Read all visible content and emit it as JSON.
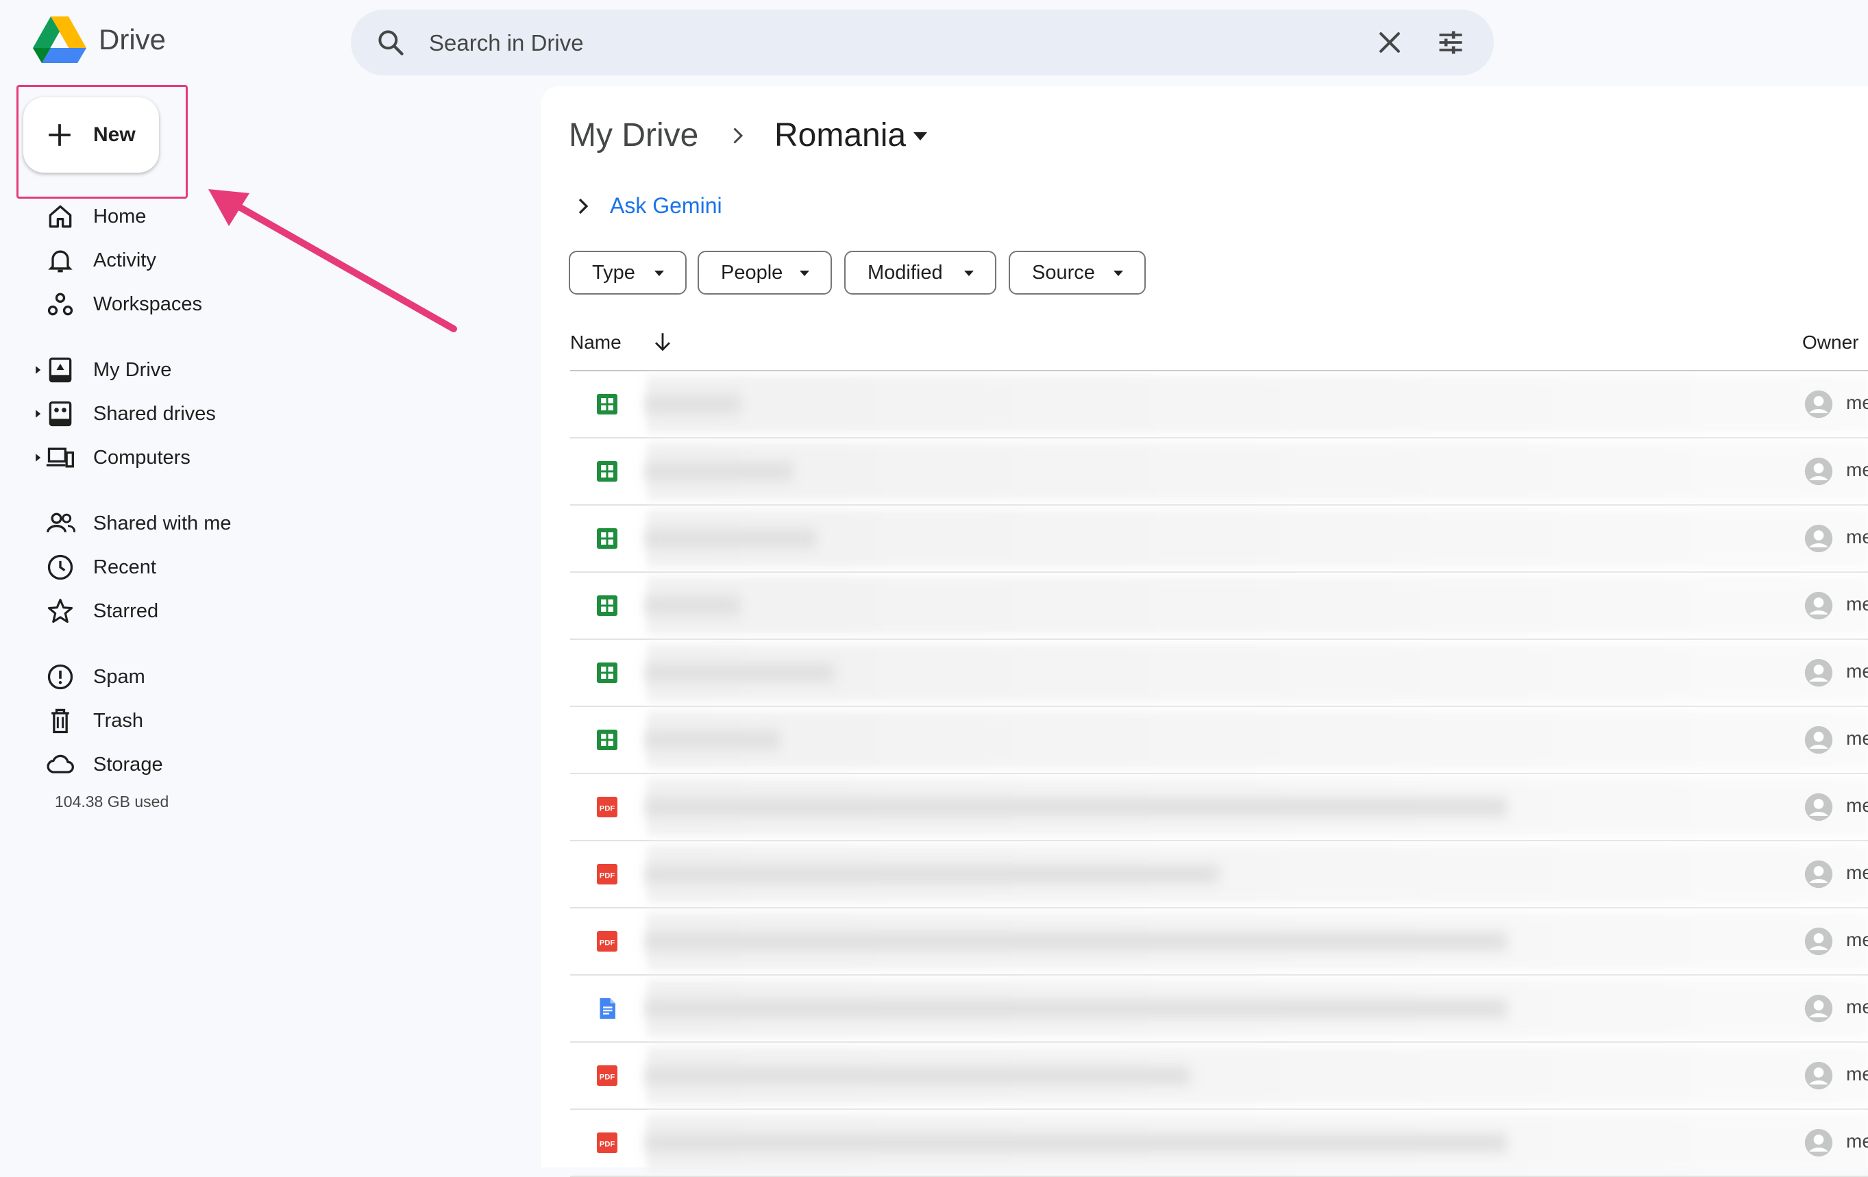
{
  "header": {
    "app_name": "Drive",
    "search_placeholder": "Search in Drive"
  },
  "new_button_label": "New",
  "sidebar": {
    "items": [
      {
        "label": "Home",
        "icon": "home-icon"
      },
      {
        "label": "Activity",
        "icon": "bell-icon"
      },
      {
        "label": "Workspaces",
        "icon": "workspaces-icon"
      },
      {
        "label": "My Drive",
        "icon": "my-drive-icon",
        "expandable": true
      },
      {
        "label": "Shared drives",
        "icon": "shared-drives-icon",
        "expandable": true
      },
      {
        "label": "Computers",
        "icon": "computers-icon",
        "expandable": true
      },
      {
        "label": "Shared with me",
        "icon": "shared-with-me-icon"
      },
      {
        "label": "Recent",
        "icon": "clock-icon"
      },
      {
        "label": "Starred",
        "icon": "star-icon"
      },
      {
        "label": "Spam",
        "icon": "spam-icon"
      },
      {
        "label": "Trash",
        "icon": "trash-icon"
      },
      {
        "label": "Storage",
        "icon": "cloud-icon"
      }
    ],
    "storage_used": "104.38 GB used"
  },
  "breadcrumb": {
    "root": "My Drive",
    "current": "Romania"
  },
  "gemini_link": "Ask Gemini",
  "filters": [
    "Type",
    "People",
    "Modified",
    "Source"
  ],
  "table": {
    "columns": {
      "name": "Name",
      "owner": "Owner"
    },
    "rows": [
      {
        "type": "sheet",
        "name": "",
        "owner": "me"
      },
      {
        "type": "sheet",
        "name": "",
        "owner": "me"
      },
      {
        "type": "sheet",
        "name": "",
        "owner": "me"
      },
      {
        "type": "sheet",
        "name": "",
        "owner": "me"
      },
      {
        "type": "sheet",
        "name": "",
        "owner": "me"
      },
      {
        "type": "sheet",
        "name": "",
        "owner": "me"
      },
      {
        "type": "pdf",
        "name": "",
        "owner": "me"
      },
      {
        "type": "pdf",
        "name": "",
        "owner": "me"
      },
      {
        "type": "pdf",
        "name": "",
        "owner": "me"
      },
      {
        "type": "doc",
        "name": "",
        "owner": "me"
      },
      {
        "type": "pdf",
        "name": "",
        "owner": "me"
      },
      {
        "type": "pdf",
        "name": "",
        "owner": "me"
      }
    ]
  },
  "colors": {
    "page_bg": "#f7f9fc",
    "search_bg": "#e9eef6",
    "link_blue": "#1a73e8",
    "annotation_pink": "#e63b77",
    "sheet_green": "#1e8e3e",
    "pdf_red": "#ea4335",
    "doc_blue": "#4285f4"
  }
}
